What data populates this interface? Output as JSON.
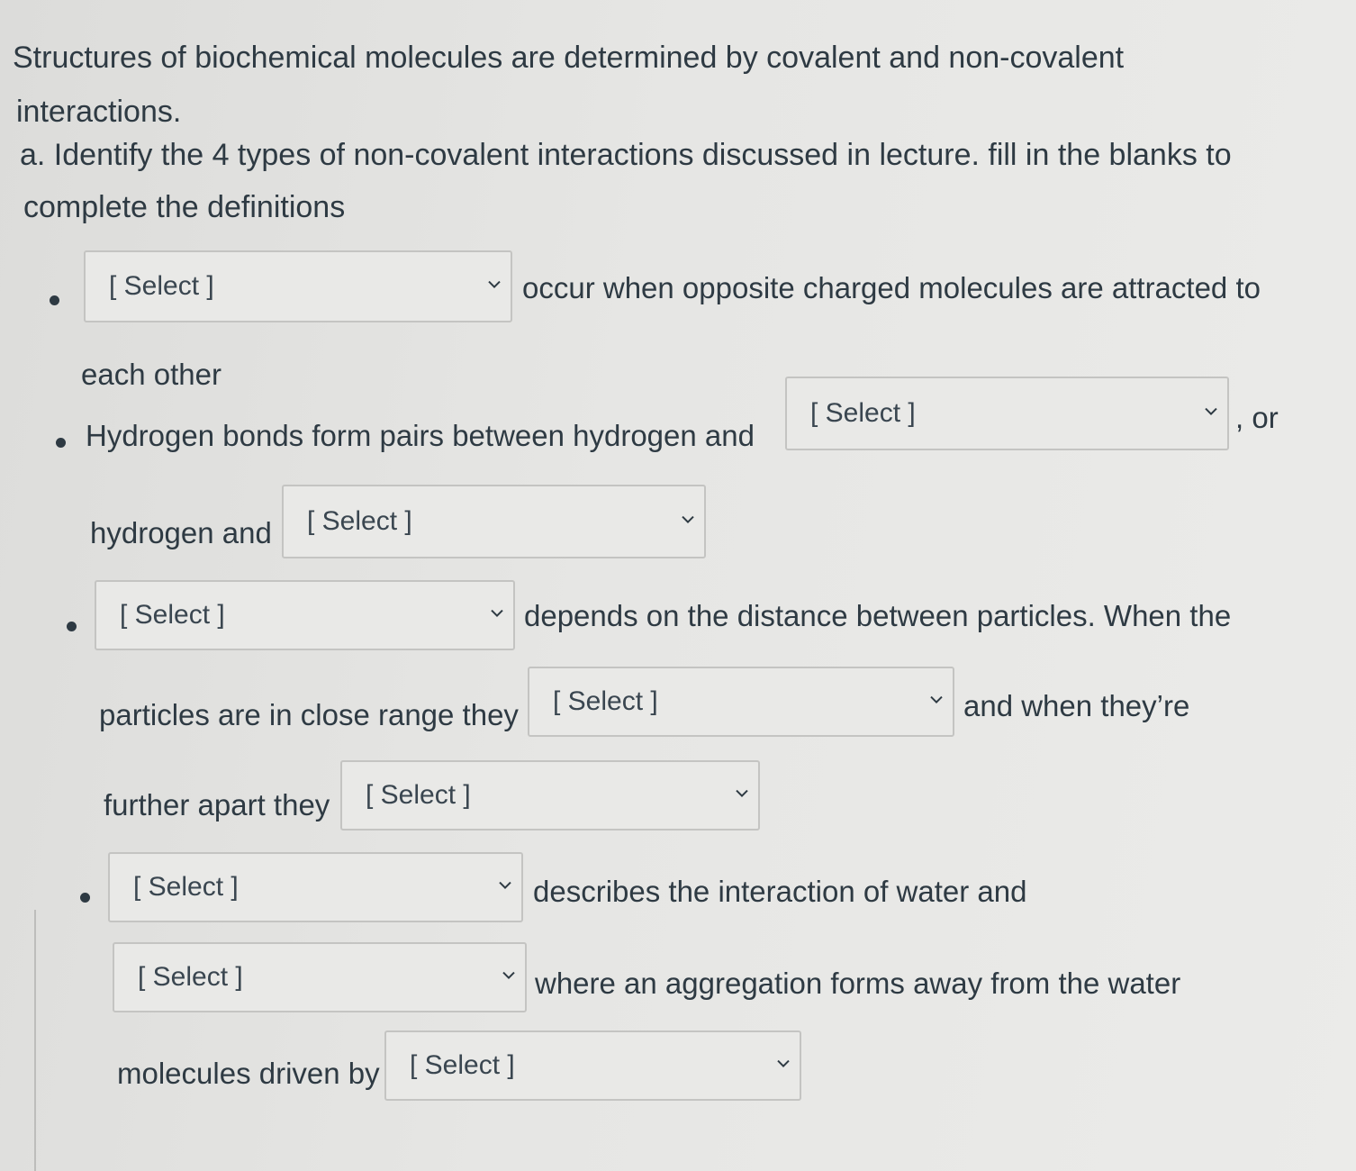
{
  "question": {
    "stem_line1": "Structures of biochemical molecules are determined by covalent and non-covalent",
    "stem_line2": "interactions.",
    "part_a_line1": "a. Identify the 4 types of non-covalent interactions discussed in lecture.  fill in the blanks to",
    "part_a_line2": "complete the definitions"
  },
  "select_placeholder": "[ Select ]",
  "items": [
    {
      "after_select_1": "occur when opposite charged molecules are attracted to",
      "continuation": "each other"
    },
    {
      "before_select_1": "Hydrogen bonds form pairs between hydrogen and",
      "after_select_1": ", or",
      "before_select_2": "hydrogen and"
    },
    {
      "after_select_1": "depends on the distance between particles. When the",
      "before_select_2": "particles are in close range they",
      "after_select_2": "and when they’re",
      "before_select_3": "further apart they"
    },
    {
      "after_select_1": "describes the interaction of water and",
      "after_select_2": "where an aggregation forms away from the water",
      "before_select_3": "molecules driven by"
    }
  ],
  "colors": {
    "background": "#e6e6e4",
    "text": "#2e3a43",
    "select_border": "#c4c4c2",
    "select_fill": "#e9e9e7"
  },
  "icons": {
    "dropdown": "chevron-down-icon",
    "bullet": "bullet-dot"
  }
}
